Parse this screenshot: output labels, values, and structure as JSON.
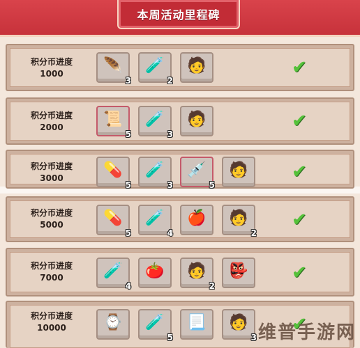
{
  "header": {
    "title": "本周活动里程碑"
  },
  "rows": [
    {
      "label": "积分币进度",
      "value": "1000",
      "items": [
        {
          "icon": "winged-pendant-icon",
          "glyph": "🪶",
          "qty": "3"
        },
        {
          "icon": "winged-potion-icon",
          "glyph": "🧪",
          "qty": "2"
        },
        {
          "icon": "character-frame-icon",
          "glyph": "🧑",
          "qty": ""
        }
      ],
      "status": "✔"
    },
    {
      "label": "积分币进度",
      "value": "2000",
      "items": [
        {
          "icon": "red-scroll-icon",
          "glyph": "📜",
          "qty": "5"
        },
        {
          "icon": "winged-potion-icon",
          "glyph": "🧪",
          "qty": "3"
        },
        {
          "icon": "character-frame-icon",
          "glyph": "🧑",
          "qty": ""
        }
      ],
      "status": "✔"
    },
    {
      "label": "积分币进度",
      "value": "3000",
      "items": [
        {
          "icon": "blue-capsule-icon",
          "glyph": "💊",
          "qty": "5"
        },
        {
          "icon": "winged-potion-icon",
          "glyph": "🧪",
          "qty": "3"
        },
        {
          "icon": "syringe-icon",
          "glyph": "💉",
          "qty": "5"
        },
        {
          "icon": "character-frame-icon",
          "glyph": "🧑",
          "qty": ""
        }
      ],
      "status": "✔"
    },
    {
      "label": "积分币进度",
      "value": "5000",
      "items": [
        {
          "icon": "blue-capsule-icon",
          "glyph": "💊",
          "qty": "5"
        },
        {
          "icon": "winged-potion-icon",
          "glyph": "🧪",
          "qty": "4"
        },
        {
          "icon": "red-apple-icon",
          "glyph": "🍎",
          "qty": ""
        },
        {
          "icon": "character-frame-icon",
          "glyph": "🧑",
          "qty": "2"
        }
      ],
      "status": "✔"
    },
    {
      "label": "积分币进度",
      "value": "7000",
      "items": [
        {
          "icon": "winged-potion-icon",
          "glyph": "🧪",
          "qty": "4"
        },
        {
          "icon": "red-fruit-icon",
          "glyph": "🍅",
          "qty": ""
        },
        {
          "icon": "character-frame-icon",
          "glyph": "🧑",
          "qty": "2"
        },
        {
          "icon": "golden-mask-icon",
          "glyph": "👺",
          "qty": ""
        }
      ],
      "status": "✔"
    },
    {
      "label": "积分币进度",
      "value": "10000",
      "items": [
        {
          "icon": "pocket-watch-icon",
          "glyph": "⌚",
          "qty": ""
        },
        {
          "icon": "winged-potion-icon",
          "glyph": "🧪",
          "qty": "5"
        },
        {
          "icon": "parchment-icon",
          "glyph": "📃",
          "qty": ""
        },
        {
          "icon": "character-frame-icon",
          "glyph": "🧑",
          "qty": "3"
        }
      ],
      "status": "✔"
    }
  ],
  "watermark": "维普手游网"
}
